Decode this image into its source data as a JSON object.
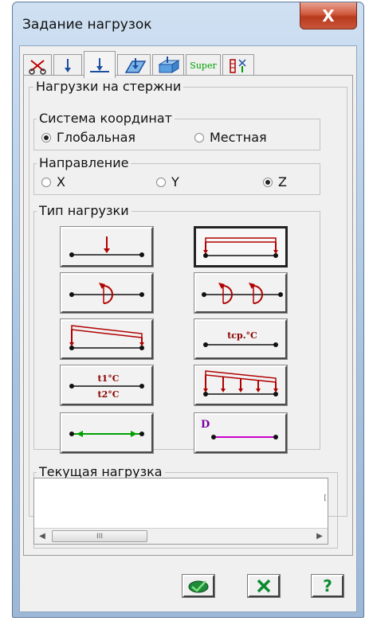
{
  "window": {
    "title": "Задание нагрузок",
    "close_glyph": "X"
  },
  "tabs": [
    {
      "icon": "scissors-icon"
    },
    {
      "icon": "node-force-icon"
    },
    {
      "icon": "bar-load-icon",
      "active": true
    },
    {
      "icon": "plate-load-icon"
    },
    {
      "icon": "solid-load-icon"
    },
    {
      "label": "Super"
    },
    {
      "icon": "load-table-icon"
    }
  ],
  "panel": {
    "title": "Нагрузки на стержни",
    "coord_system": {
      "label": "Система координат",
      "options": [
        {
          "label": "Глобальная",
          "selected": true
        },
        {
          "label": "Местная",
          "selected": false
        }
      ]
    },
    "direction": {
      "label": "Направление",
      "options": [
        {
          "label": "X",
          "selected": false
        },
        {
          "label": "Y",
          "selected": false
        },
        {
          "label": "Z",
          "selected": true
        }
      ]
    },
    "load_type": {
      "label": "Тип нагрузки",
      "buttons": [
        {
          "name": "concentrated-force-icon"
        },
        {
          "name": "uniform-distributed-load-icon",
          "selected": true
        },
        {
          "name": "concentrated-moment-icon"
        },
        {
          "name": "distributed-moment-icon"
        },
        {
          "name": "trapezoidal-load-icon"
        },
        {
          "name": "uniform-temperature-icon",
          "text": "tср.°C"
        },
        {
          "name": "temperature-gradient-icon",
          "text_top": "t1°C",
          "text_bottom": "t2°C"
        },
        {
          "name": "multi-trapezoid-load-icon"
        },
        {
          "name": "axial-force-icon"
        },
        {
          "name": "dynamic-load-icon",
          "text": "D"
        }
      ]
    },
    "current_load": {
      "label": "Текущая нагрузка",
      "scroll_thumb": "III",
      "edge_char": "["
    }
  },
  "footer": {
    "buttons": [
      {
        "name": "apply-button",
        "icon": "apply-icon"
      },
      {
        "name": "cancel-button",
        "icon": "cancel-icon"
      },
      {
        "name": "help-button",
        "glyph": "?"
      }
    ]
  },
  "colors": {
    "load_red": "#b00000",
    "axial_green": "#00a000",
    "dynamic_magenta": "#cc00cc",
    "accent_blue": "#1c4fa0"
  }
}
